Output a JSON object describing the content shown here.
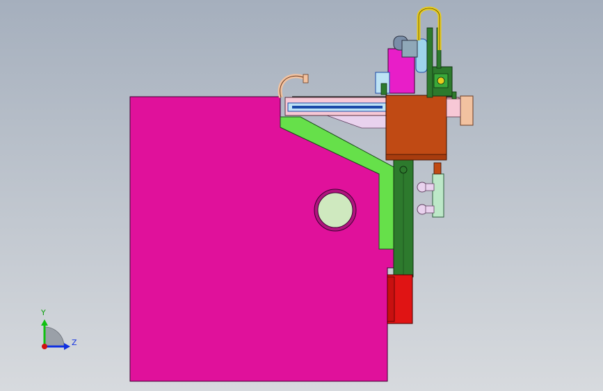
{
  "viewport": {
    "background_top": "#a5afbd",
    "background_bottom": "#d7dade"
  },
  "colors": {
    "body_magenta": "#e0119b",
    "inner_magenta": "#b0147e",
    "window_fill": "#cfe9bf",
    "green_strip": "#66e04a",
    "dark_green": "#2d7a2d",
    "carriage_brown": "#c04a14",
    "red_block": "#e01414",
    "bracket_pink": "#f7c8d6",
    "light_blue": "#bde3f5",
    "accent_blue": "#1a4aa8",
    "yellow_cable": "#e8cc1e",
    "peach": "#f2c2a0",
    "lavender": "#e9d2ee",
    "mint": "#bde8c8"
  },
  "triad": {
    "y_label": "Y",
    "z_label": "Z",
    "x_color": "#d01010",
    "y_color": "#10c010",
    "z_color": "#1030e0",
    "icon": "coordinate-triad-icon"
  }
}
